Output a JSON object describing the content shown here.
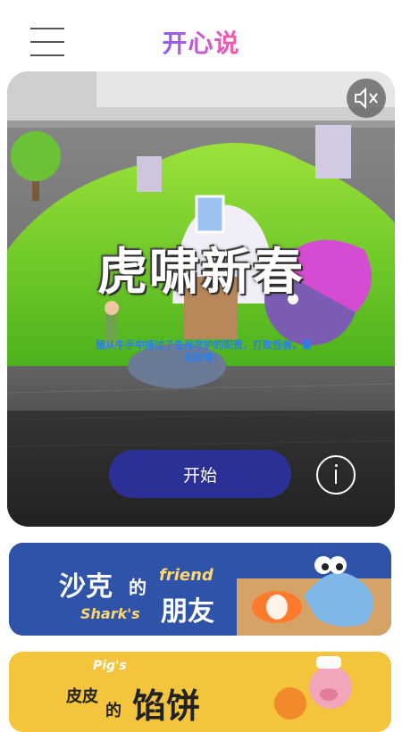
{
  "app": {
    "title": "开心说"
  },
  "hero": {
    "title": "虎啸新春",
    "subtitle": "猪从牛手中接过了生肖守护的职责，打败怪兽，喜迎新春！",
    "start_label": "开始",
    "icons": {
      "mute": "mute-icon",
      "info": "info-icon"
    }
  },
  "stories": [
    {
      "cn_part1": "沙克",
      "cn_part2": "的",
      "cn_part3": "朋友",
      "en_part1": "friend",
      "en_part2": "Shark's"
    },
    {
      "en_top": "Pig's",
      "cn_part1": "皮皮",
      "cn_part2": "的",
      "cn_part3": "馅饼"
    }
  ],
  "colors": {
    "title_gradient": [
      "#8a5cff",
      "#ff5aa0"
    ],
    "start_button": "#2c2f96",
    "card1": "#2e53a8",
    "card2": "#f4c53c"
  }
}
